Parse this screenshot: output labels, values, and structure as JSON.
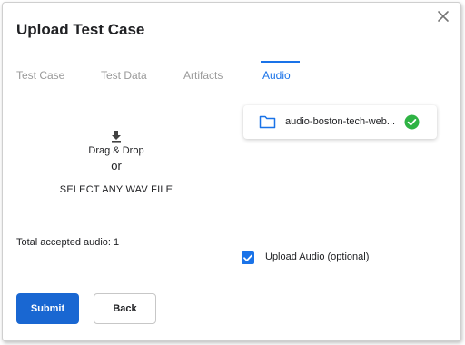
{
  "dialog": {
    "title": "Upload Test Case"
  },
  "tabs": [
    {
      "label": "Test Case",
      "active": false
    },
    {
      "label": "Test Data",
      "active": false
    },
    {
      "label": "Artifacts",
      "active": false
    },
    {
      "label": "Audio",
      "active": true
    }
  ],
  "upload": {
    "drag_label": "Drag & Drop",
    "or_label": "or",
    "select_label": "SELECT ANY WAV FILE",
    "icon": "download-icon"
  },
  "file_card": {
    "file_name": "audio-boston-tech-web...",
    "folder_icon": "folder-icon",
    "status_icon": "check-circle-icon",
    "status_color": "#2fb344"
  },
  "total_label": "Total accepted audio: 1",
  "upload_audio_option": {
    "label": "Upload Audio (optional)",
    "checked": true
  },
  "buttons": {
    "submit_label": "Submit",
    "back_label": "Back"
  },
  "colors": {
    "accent": "#1a73e8",
    "primary_button": "#1967d2",
    "inactive_tab": "#9a9a9a"
  }
}
